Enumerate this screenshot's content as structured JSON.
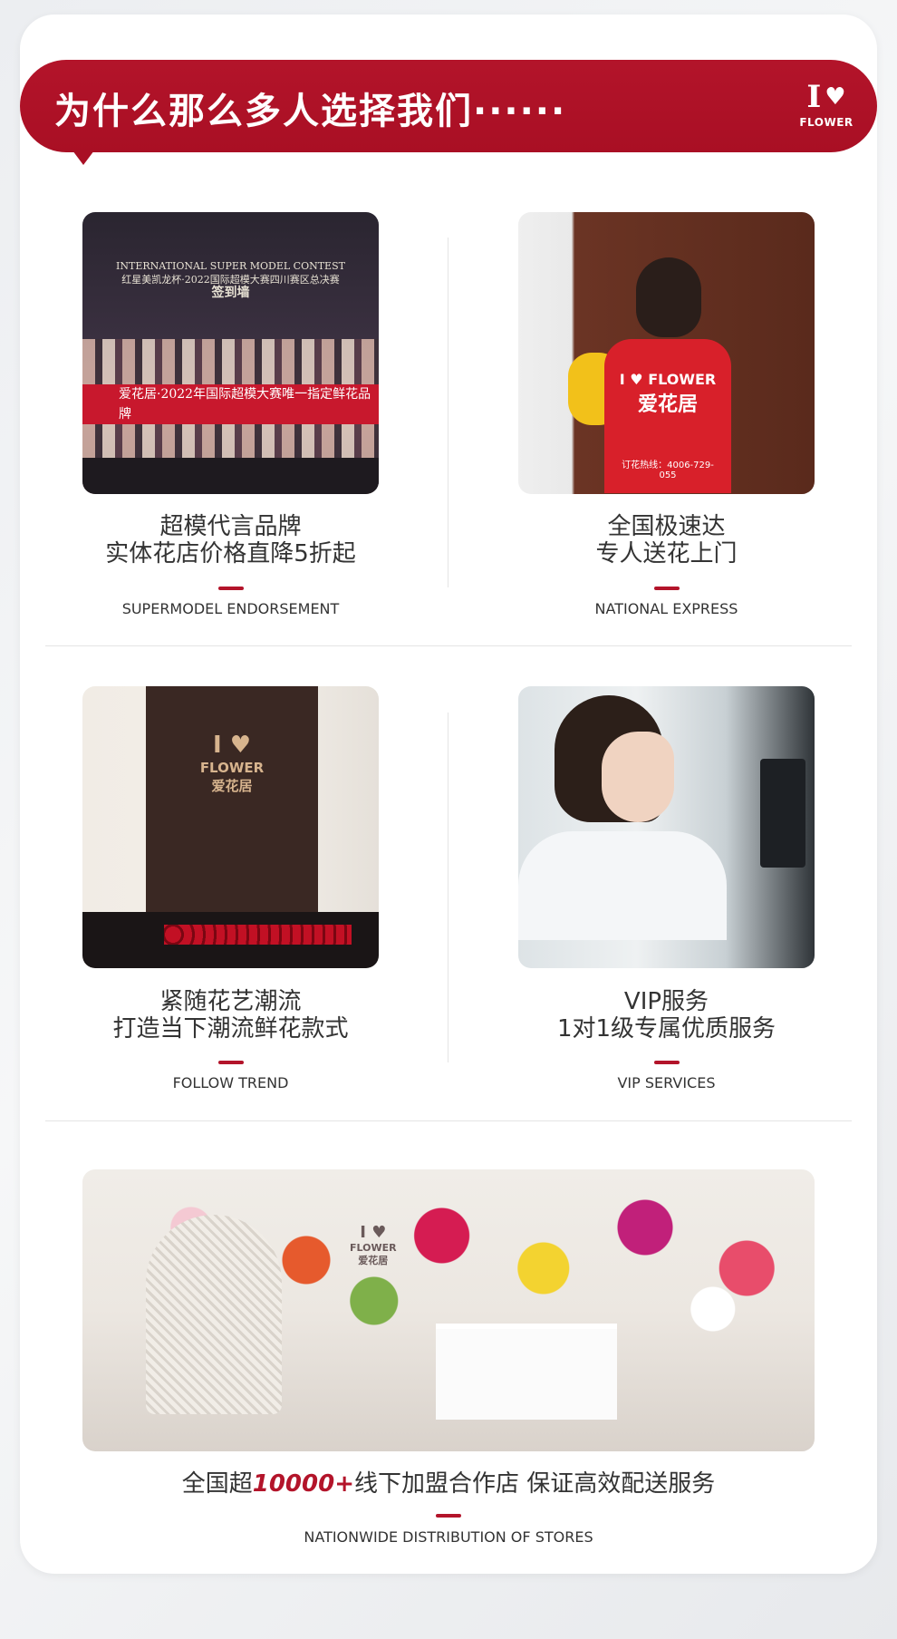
{
  "header": {
    "title": "为什么那么多人选择我们······",
    "logo_letter": "I",
    "logo_heart": "♥",
    "logo_word": "FLOWER"
  },
  "features": [
    {
      "cn_line1": "超模代言品牌",
      "cn_line2": "实体花店价格直降5折起",
      "en": "SUPERMODEL ENDORSEMENT",
      "photo_text_1": "INTERNATIONAL SUPER MODEL CONTEST",
      "photo_text_2": "红星美凯龙杯·2022国际超模大赛四川赛区总决赛",
      "photo_text_3": "签到墙",
      "photo_banner": "爱花居·2022年国际超模大赛唯一指定鲜花品牌"
    },
    {
      "cn_line1": "全国极速达",
      "cn_line2": "专人送花上门",
      "en": "NATIONAL EXPRESS",
      "photo_vest_1": "I ♥ FLOWER",
      "photo_vest_2": "爱花居",
      "photo_phone": "订花热线：4006-729-055"
    },
    {
      "cn_line1": "紧随花艺潮流",
      "cn_line2": "打造当下潮流鲜花款式",
      "en": "FOLLOW TREND",
      "photo_logo_1": "I ♥",
      "photo_logo_2": "FLOWER",
      "photo_logo_3": "爱花居"
    },
    {
      "cn_line1": "VIP服务",
      "cn_line2": "1对1级专属优质服务",
      "en": "VIP SERVICES"
    }
  ],
  "bottom": {
    "text_before": "全国超",
    "highlight": "10000+",
    "text_after": "线下加盟合作店 保证高效配送服务",
    "en": "NATIONWIDE DISTRIBUTION OF STORES",
    "sign_1": "I ♥",
    "sign_2": "FLOWER",
    "sign_3": "爱花居"
  },
  "colors": {
    "brand_red": "#b3142a",
    "text": "#333333",
    "card_bg": "#ffffff"
  }
}
